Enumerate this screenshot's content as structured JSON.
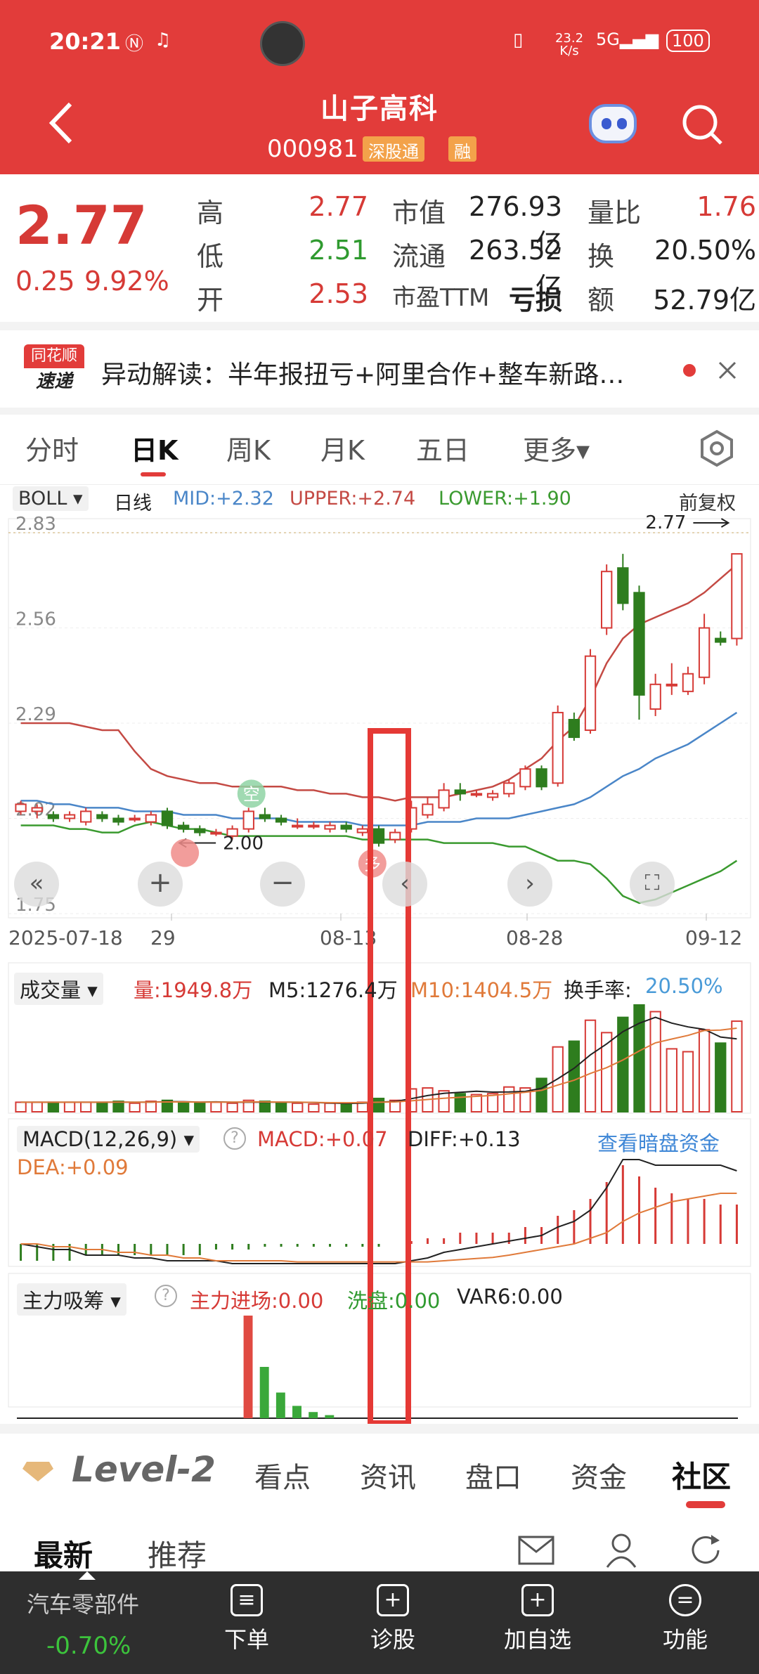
{
  "status_bar": {
    "time": "20:21",
    "net_speed": "23.2 K/s",
    "battery": "100"
  },
  "header": {
    "title": "山子高科",
    "code": "000981",
    "tag1": "深股通",
    "tag2": "融"
  },
  "quote": {
    "price": "2.77",
    "change": "0.25",
    "change_pct": "9.92%",
    "high_label": "高",
    "high": "2.77",
    "low_label": "低",
    "low": "2.51",
    "open_label": "开",
    "open": "2.53",
    "mcap_label": "市值",
    "mcap": "276.93亿",
    "float_label": "流通",
    "float": "263.52亿",
    "pe_label": "市盈TTM",
    "pe": "亏损",
    "vol_ratio_label": "量比",
    "vol_ratio": "1.76",
    "turnover_label": "换",
    "turnover": "20.50%",
    "amount_label": "额",
    "amount": "52.79亿"
  },
  "news": {
    "badge_top": "同花顺",
    "badge_bottom": "速递",
    "text": "异动解读：半年报扭亏+阿里合作+整车新路…"
  },
  "tabs": [
    "分时",
    "日K",
    "周K",
    "月K",
    "五日",
    "更多▾"
  ],
  "active_tab": "日K",
  "indicator": {
    "name": "BOLL ▾",
    "period": "日线",
    "mid": "MID:+2.32",
    "upper": "UPPER:+2.74",
    "lower": "LOWER:+1.90",
    "adjust": "前复权"
  },
  "colors": {
    "up": "#d63a36",
    "down": "#2e7d1e",
    "mid": "#4a86c8",
    "upper": "#c44a44",
    "lower": "#3a9a2f",
    "accent": "#e23c3a"
  },
  "chart_data": [
    {
      "type": "candlestick",
      "title": "BOLL",
      "y_ticks": [
        "2.83",
        "2.56",
        "2.29",
        "2.02",
        "1.75"
      ],
      "ylim": [
        1.75,
        2.83
      ],
      "x_ticks": [
        "2025-07-18",
        "29",
        "08-13",
        "08-28",
        "09-12"
      ],
      "annotations": {
        "high_marker": "2.77",
        "low_marker": "2.00",
        "bubble_kong": "空",
        "bubble_duo": "多"
      },
      "candles": [
        {
          "o": 2.04,
          "c": 2.06,
          "h": 2.07,
          "l": 2.03
        },
        {
          "o": 2.04,
          "c": 2.05,
          "h": 2.06,
          "l": 2.02
        },
        {
          "o": 2.03,
          "c": 2.02,
          "h": 2.04,
          "l": 2.01
        },
        {
          "o": 2.02,
          "c": 2.03,
          "h": 2.04,
          "l": 2.01
        },
        {
          "o": 2.01,
          "c": 2.04,
          "h": 2.05,
          "l": 2.0
        },
        {
          "o": 2.03,
          "c": 2.02,
          "h": 2.04,
          "l": 2.01
        },
        {
          "o": 2.02,
          "c": 2.01,
          "h": 2.03,
          "l": 2.0
        },
        {
          "o": 2.02,
          "c": 2.02,
          "h": 2.03,
          "l": 2.01
        },
        {
          "o": 2.01,
          "c": 2.03,
          "h": 2.04,
          "l": 2.0
        },
        {
          "o": 2.04,
          "c": 2.0,
          "h": 2.05,
          "l": 1.99
        },
        {
          "o": 2.0,
          "c": 1.99,
          "h": 2.01,
          "l": 1.98
        },
        {
          "o": 1.99,
          "c": 1.98,
          "h": 2.0,
          "l": 1.97
        },
        {
          "o": 1.98,
          "c": 1.98,
          "h": 1.99,
          "l": 1.97
        },
        {
          "o": 1.97,
          "c": 1.99,
          "h": 2.0,
          "l": 1.96
        },
        {
          "o": 1.99,
          "c": 2.04,
          "h": 2.05,
          "l": 1.98
        },
        {
          "o": 2.03,
          "c": 2.02,
          "h": 2.05,
          "l": 2.01
        },
        {
          "o": 2.02,
          "c": 2.01,
          "h": 2.03,
          "l": 2.0
        },
        {
          "o": 2.0,
          "c": 2.0,
          "h": 2.02,
          "l": 1.99
        },
        {
          "o": 2.0,
          "c": 2.0,
          "h": 2.01,
          "l": 1.99
        },
        {
          "o": 1.99,
          "c": 2.0,
          "h": 2.01,
          "l": 1.98
        },
        {
          "o": 2.0,
          "c": 1.99,
          "h": 2.01,
          "l": 1.98
        },
        {
          "o": 1.98,
          "c": 1.99,
          "h": 2.0,
          "l": 1.97
        },
        {
          "o": 1.99,
          "c": 1.95,
          "h": 2.0,
          "l": 1.94
        },
        {
          "o": 1.96,
          "c": 1.98,
          "h": 1.99,
          "l": 1.95
        },
        {
          "o": 1.99,
          "c": 2.05,
          "h": 2.07,
          "l": 1.98
        },
        {
          "o": 2.03,
          "c": 2.06,
          "h": 2.08,
          "l": 2.02
        },
        {
          "o": 2.05,
          "c": 2.1,
          "h": 2.12,
          "l": 2.04
        },
        {
          "o": 2.1,
          "c": 2.09,
          "h": 2.12,
          "l": 2.07
        },
        {
          "o": 2.09,
          "c": 2.09,
          "h": 2.1,
          "l": 2.08
        },
        {
          "o": 2.08,
          "c": 2.09,
          "h": 2.1,
          "l": 2.07
        },
        {
          "o": 2.09,
          "c": 2.12,
          "h": 2.13,
          "l": 2.08
        },
        {
          "o": 2.11,
          "c": 2.16,
          "h": 2.17,
          "l": 2.1
        },
        {
          "o": 2.16,
          "c": 2.11,
          "h": 2.17,
          "l": 2.1
        },
        {
          "o": 2.12,
          "c": 2.32,
          "h": 2.34,
          "l": 2.11
        },
        {
          "o": 2.3,
          "c": 2.25,
          "h": 2.32,
          "l": 2.24
        },
        {
          "o": 2.27,
          "c": 2.48,
          "h": 2.5,
          "l": 2.26
        },
        {
          "o": 2.56,
          "c": 2.72,
          "h": 2.74,
          "l": 2.54
        },
        {
          "o": 2.73,
          "c": 2.63,
          "h": 2.77,
          "l": 2.61
        },
        {
          "o": 2.66,
          "c": 2.37,
          "h": 2.68,
          "l": 2.3
        },
        {
          "o": 2.33,
          "c": 2.4,
          "h": 2.43,
          "l": 2.31
        },
        {
          "o": 2.4,
          "c": 2.4,
          "h": 2.46,
          "l": 2.37
        },
        {
          "o": 2.38,
          "c": 2.43,
          "h": 2.45,
          "l": 2.37
        },
        {
          "o": 2.42,
          "c": 2.56,
          "h": 2.6,
          "l": 2.4
        },
        {
          "o": 2.53,
          "c": 2.52,
          "h": 2.55,
          "l": 2.51
        },
        {
          "o": 2.53,
          "c": 2.77,
          "h": 2.77,
          "l": 2.51
        }
      ],
      "mid": [
        2.07,
        2.07,
        2.06,
        2.06,
        2.05,
        2.05,
        2.05,
        2.04,
        2.04,
        2.04,
        2.03,
        2.03,
        2.03,
        2.02,
        2.02,
        2.02,
        2.02,
        2.01,
        2.01,
        2.01,
        2.01,
        2.0,
        2.0,
        2.0,
        2.0,
        2.01,
        2.01,
        2.01,
        2.02,
        2.02,
        2.02,
        2.03,
        2.04,
        2.05,
        2.06,
        2.08,
        2.11,
        2.14,
        2.16,
        2.19,
        2.21,
        2.23,
        2.26,
        2.29,
        2.32
      ],
      "upper": [
        2.29,
        2.29,
        2.29,
        2.29,
        2.28,
        2.27,
        2.27,
        2.21,
        2.16,
        2.14,
        2.13,
        2.12,
        2.12,
        2.11,
        2.11,
        2.11,
        2.11,
        2.1,
        2.1,
        2.09,
        2.09,
        2.08,
        2.08,
        2.07,
        2.08,
        2.08,
        2.08,
        2.09,
        2.1,
        2.11,
        2.13,
        2.16,
        2.19,
        2.24,
        2.28,
        2.36,
        2.46,
        2.53,
        2.57,
        2.59,
        2.61,
        2.63,
        2.66,
        2.7,
        2.74
      ],
      "lower": [
        2.0,
        2.0,
        2.0,
        1.99,
        1.99,
        1.98,
        1.98,
        2.0,
        2.01,
        2.0,
        1.99,
        1.99,
        1.98,
        1.97,
        1.97,
        1.97,
        1.97,
        1.97,
        1.97,
        1.97,
        1.97,
        1.96,
        1.96,
        1.96,
        1.96,
        1.96,
        1.95,
        1.95,
        1.95,
        1.95,
        1.94,
        1.94,
        1.92,
        1.9,
        1.9,
        1.89,
        1.85,
        1.8,
        1.78,
        1.79,
        1.81,
        1.83,
        1.85,
        1.87,
        1.9
      ]
    },
    {
      "type": "bar",
      "title": "成交量 ▾",
      "labels": {
        "vol": "量:1949.8万",
        "m5": "M5:1276.4万",
        "m10": "M10:1404.5万",
        "turn_label": "换手率:",
        "turn": "20.50%"
      },
      "values": [
        1.0,
        1.0,
        1.0,
        1.0,
        1.0,
        1.0,
        1.1,
        0.9,
        1.1,
        1.2,
        1.0,
        0.9,
        1.0,
        0.9,
        1.2,
        1.1,
        0.9,
        0.9,
        0.8,
        0.9,
        0.9,
        1.0,
        1.4,
        1.2,
        2.4,
        2.5,
        2.2,
        1.9,
        1.8,
        1.9,
        2.6,
        2.5,
        3.5,
        6.8,
        7.4,
        9.6,
        8.3,
        9.9,
        11.2,
        10.5,
        6.6,
        6.3,
        8.6,
        7.2,
        9.5
      ]
    },
    {
      "type": "bar",
      "title": "MACD(12,26,9) ▾",
      "labels": {
        "macd": "MACD:+0.07",
        "diff": "DIFF:+0.13",
        "dea": "DEA:+0.09",
        "link": "查看暗盘资金"
      },
      "macd": [
        -0.03,
        -0.03,
        -0.03,
        -0.03,
        -0.02,
        -0.02,
        -0.02,
        -0.02,
        -0.02,
        -0.02,
        -0.02,
        -0.02,
        -0.01,
        -0.01,
        -0.01,
        -0.005,
        -0.005,
        -0.005,
        -0.005,
        -0.005,
        -0.005,
        -0.005,
        -0.005,
        0.0,
        0.005,
        0.01,
        0.01,
        0.02,
        0.02,
        0.02,
        0.02,
        0.03,
        0.03,
        0.05,
        0.06,
        0.08,
        0.11,
        0.14,
        0.12,
        0.1,
        0.09,
        0.08,
        0.08,
        0.07,
        0.07
      ],
      "diff": [
        0.0,
        -0.005,
        -0.01,
        -0.01,
        -0.02,
        -0.02,
        -0.02,
        -0.025,
        -0.025,
        -0.03,
        -0.03,
        -0.03,
        -0.03,
        -0.035,
        -0.035,
        -0.035,
        -0.035,
        -0.035,
        -0.035,
        -0.035,
        -0.035,
        -0.035,
        -0.035,
        -0.035,
        -0.03,
        -0.025,
        -0.015,
        -0.01,
        -0.005,
        0.0,
        0.005,
        0.01,
        0.015,
        0.03,
        0.04,
        0.06,
        0.1,
        0.15,
        0.15,
        0.14,
        0.14,
        0.14,
        0.14,
        0.14,
        0.13
      ],
      "dea": [
        0.0,
        0.0,
        -0.005,
        -0.005,
        -0.01,
        -0.01,
        -0.015,
        -0.015,
        -0.02,
        -0.02,
        -0.025,
        -0.025,
        -0.03,
        -0.03,
        -0.03,
        -0.03,
        -0.03,
        -0.032,
        -0.032,
        -0.032,
        -0.032,
        -0.032,
        -0.032,
        -0.032,
        -0.032,
        -0.032,
        -0.03,
        -0.028,
        -0.026,
        -0.024,
        -0.02,
        -0.015,
        -0.01,
        -0.005,
        0.0,
        0.01,
        0.02,
        0.04,
        0.055,
        0.065,
        0.075,
        0.08,
        0.085,
        0.09,
        0.09
      ]
    },
    {
      "type": "bar",
      "title": "主力吸筹 ▾",
      "labels": {
        "a": "主力进场:0.00",
        "b": "洗盘:0.00",
        "c": "VAR6:0.00"
      },
      "entry": [
        0,
        0,
        0,
        0,
        0,
        0,
        0,
        0,
        0,
        0,
        0,
        0,
        0,
        0,
        1.0,
        0,
        0,
        0,
        0,
        0,
        0,
        0,
        0,
        0,
        0,
        0,
        0,
        0,
        0,
        0,
        0,
        0,
        0,
        0,
        0,
        0,
        0,
        0,
        0,
        0,
        0,
        0,
        0,
        0,
        0
      ],
      "wash": [
        0,
        0,
        0,
        0,
        0,
        0,
        0,
        0,
        0,
        0,
        0,
        0,
        0,
        0,
        0,
        0.5,
        0.25,
        0.12,
        0.06,
        0.03,
        0,
        0,
        0,
        0,
        0,
        0,
        0,
        0,
        0,
        0,
        0,
        0,
        0,
        0,
        0,
        0,
        0,
        0,
        0,
        0,
        0,
        0,
        0,
        0,
        0
      ]
    }
  ],
  "bottom_tabs": {
    "logo": "Level-2",
    "items": [
      "看点",
      "资讯",
      "盘口",
      "资金",
      "社区"
    ],
    "active": "社区"
  },
  "sub_tabs": [
    "最新",
    "推荐"
  ],
  "footer": {
    "sector": "汽车零部件",
    "sector_change": "-0.70%",
    "items": [
      "下单",
      "诊股",
      "加自选",
      "功能"
    ]
  }
}
